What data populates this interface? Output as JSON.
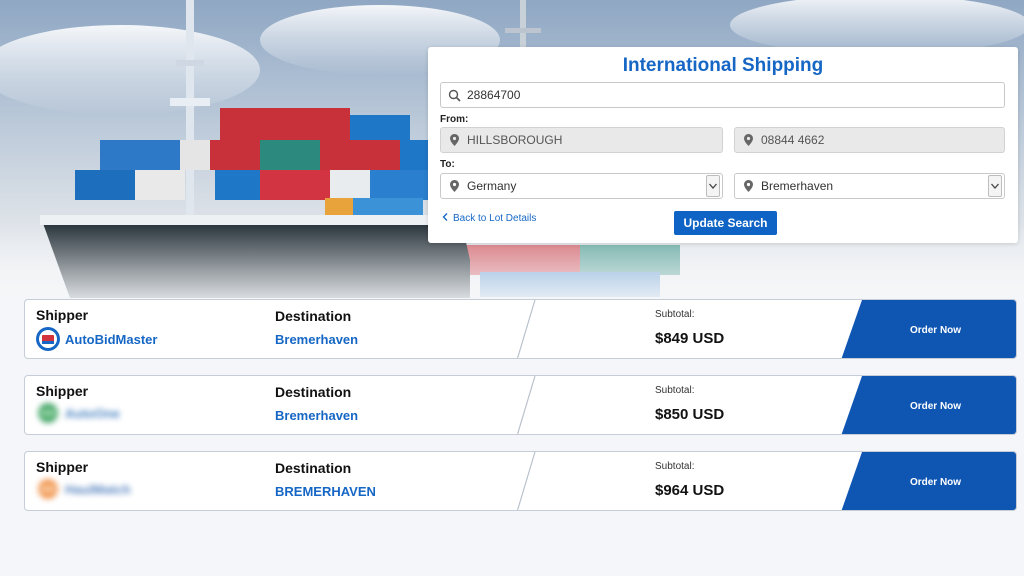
{
  "search": {
    "title": "International Shipping",
    "lot_query": "28864700",
    "from_label": "From:",
    "from_city": "HILLSBOROUGH",
    "from_zip": "08844 4662",
    "to_label": "To:",
    "to_country": "Germany",
    "to_port": "Bremerhaven",
    "back_link": "Back to Lot Details",
    "update_button": "Update Search"
  },
  "results": {
    "shipper_header": "Shipper",
    "destination_header": "Destination",
    "subtotal_label": "Subtotal:",
    "order_label": "Order Now",
    "rows": [
      {
        "shipper": "AutoBidMaster",
        "destination": "Bremerhaven",
        "price": "$849 USD"
      },
      {
        "shipper": "AutoOne",
        "destination": "Bremerhaven",
        "price": "$850 USD"
      },
      {
        "shipper": "HaulMatch",
        "destination": "BREMERHAVEN",
        "price": "$964 USD"
      }
    ]
  },
  "colors": {
    "brand_blue": "#1667c5",
    "button_blue": "#0f56b3"
  },
  "icons": {
    "search": "magnifier-icon",
    "location": "map-pin-icon",
    "dropdown": "chevron-down-icon",
    "back": "chevron-left-icon"
  }
}
